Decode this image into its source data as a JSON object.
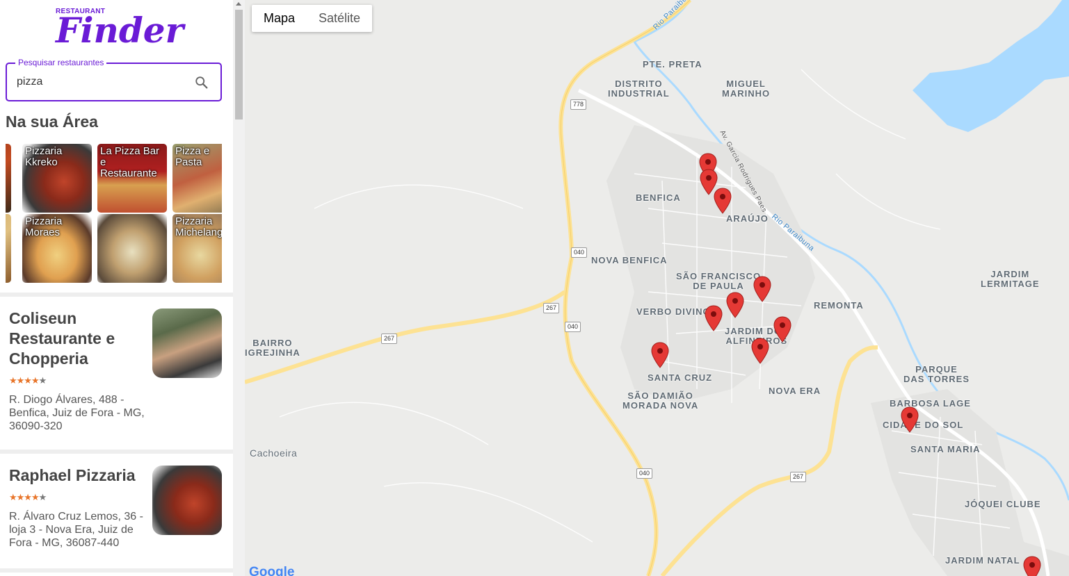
{
  "logo": {
    "small": "RESTAURANT",
    "big": "Finder"
  },
  "search": {
    "legend": "Pesquisar restaurantes",
    "value": "pizza"
  },
  "section_title": "Na sua Área",
  "carousel": [
    {
      "label": "Pizzaria\nKkreko"
    },
    {
      "label": "La Pizza Bar\ne\nRestaurante"
    },
    {
      "label": "Pizza e\nPasta"
    },
    {
      "label": "Pizzaria\nMoraes"
    },
    {
      "label": ""
    },
    {
      "label": "Pizzaria\nMichelangelo"
    }
  ],
  "restaurants": [
    {
      "name": "Coliseun Restaurante e Chopperia",
      "stars_on": "★★★★",
      "stars_off": "★",
      "rating": 4,
      "address": "R. Diogo Álvares, 488 - Benfica, Juiz de Fora - MG, 36090-320"
    },
    {
      "name": "Raphael Pizzaria",
      "stars_on": "★★★★",
      "stars_off": "★",
      "rating": 4,
      "address": "R. Álvaro Cruz Lemos, 36 - loja 3 - Nova Era, Juiz de Fora - MG, 36087-440"
    }
  ],
  "map": {
    "type_buttons": {
      "map": "Mapa",
      "satellite": "Satélite"
    },
    "places": {
      "pte_preta": "PTE. PRETA",
      "distrito": "DISTRITO\nINDUSTRIAL",
      "miguel": "MIGUEL\nMARINHO",
      "benfica": "BENFICA",
      "araujo": "ARAÚJO",
      "nova_benfica": "NOVA BENFICA",
      "sao_francisco": "SÃO FRANCISCO\nDE PAULA",
      "verbo": "VERBO DIVINO",
      "jardim_alf": "JARDIM DOS\nALFINEIROS",
      "remonta": "REMONTA",
      "jardim_lermitage": "JARDIM\nLERMITAGE",
      "bairro_igrejinha": "BAIRRO\nIGREJINHA",
      "santa_cruz": "SANTA CRUZ",
      "sao_damiao": "SÃO DAMIÃO\nMORADA NOVA",
      "nova_era": "NOVA ERA",
      "parque_torres": "PARQUE\nDAS TORRES",
      "barbosa_lage": "BARBOSA LAGE",
      "cidade_sol": "CIDADE DO SOL",
      "santa_maria": "SANTA MARIA",
      "jockei": "JÓQUEI CLUBE",
      "jardim_natal": "JARDIM NATAL",
      "cachoeira": "Cachoeira"
    },
    "roads": {
      "r778": "778",
      "r040a": "040",
      "r040b": "040",
      "r040c": "040",
      "r267a": "267",
      "r267b": "267",
      "r267c": "267"
    },
    "street_labels": {
      "rio_paraibuna_top": "Rio Paraibu",
      "av_garcia": "Av. Garcia Rodrigues Paes",
      "rio_paraibuna": "Rio Paraibuna"
    },
    "attribution": "Google",
    "pin_color": "#e53935"
  },
  "colors": {
    "accent": "#6a1bd6",
    "star": "#e8752a",
    "water": "#aadaff",
    "road_major": "#fde293"
  }
}
